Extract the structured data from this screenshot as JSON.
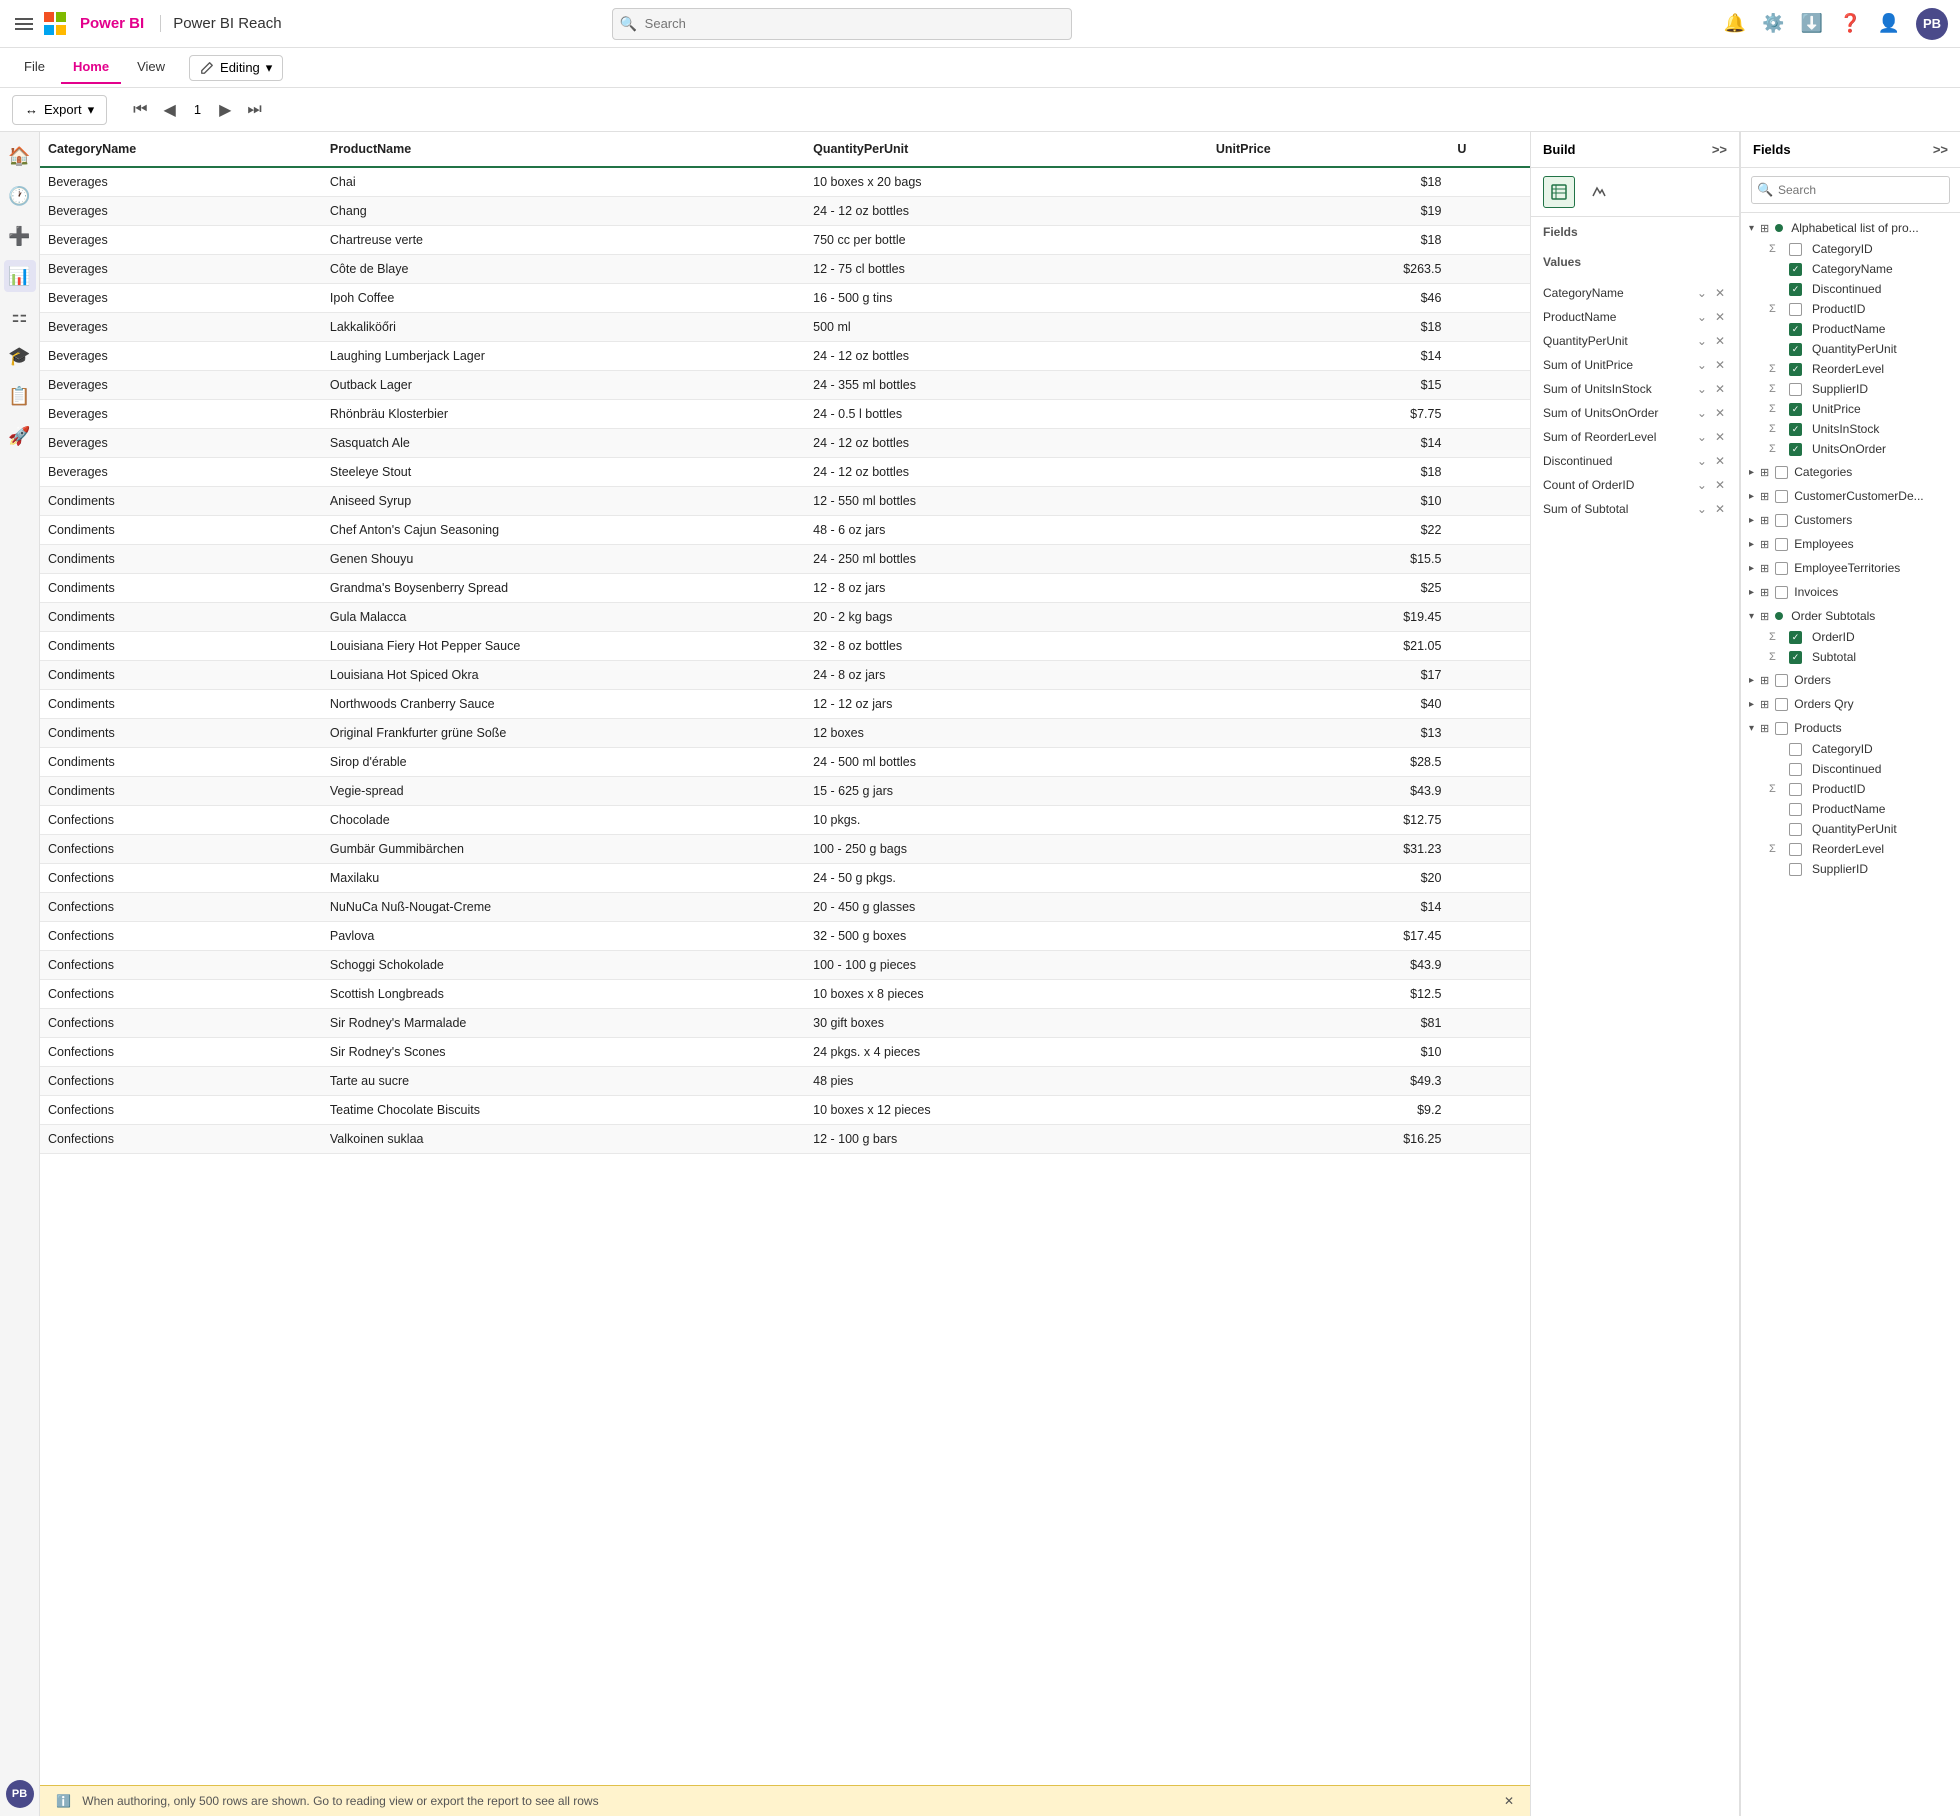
{
  "topbar": {
    "brand": "Power BI",
    "product": "Power BI Reach",
    "search_placeholder": "Search",
    "avatar_initials": "PB"
  },
  "ribbon": {
    "tabs": [
      "File",
      "Home",
      "View"
    ],
    "active_tab": "Home",
    "editing_label": "Editing"
  },
  "toolbar": {
    "export_label": "Export",
    "page_number": "1"
  },
  "table": {
    "headers": [
      "CategoryName",
      "ProductName",
      "QuantityPerUnit",
      "UnitPrice",
      "U"
    ],
    "rows": [
      [
        "Beverages",
        "Chai",
        "10 boxes x 20 bags",
        "$18",
        ""
      ],
      [
        "Beverages",
        "Chang",
        "24 - 12 oz bottles",
        "$19",
        ""
      ],
      [
        "Beverages",
        "Chartreuse verte",
        "750 cc per bottle",
        "$18",
        ""
      ],
      [
        "Beverages",
        "Côte de Blaye",
        "12 - 75 cl bottles",
        "$263.5",
        ""
      ],
      [
        "Beverages",
        "Ipoh Coffee",
        "16 - 500 g tins",
        "$46",
        ""
      ],
      [
        "Beverages",
        "Lakkaliköőri",
        "500 ml",
        "$18",
        ""
      ],
      [
        "Beverages",
        "Laughing Lumberjack Lager",
        "24 - 12 oz bottles",
        "$14",
        ""
      ],
      [
        "Beverages",
        "Outback Lager",
        "24 - 355 ml bottles",
        "$15",
        ""
      ],
      [
        "Beverages",
        "Rhönbräu Klosterbier",
        "24 - 0.5 l bottles",
        "$7.75",
        ""
      ],
      [
        "Beverages",
        "Sasquatch Ale",
        "24 - 12 oz bottles",
        "$14",
        ""
      ],
      [
        "Beverages",
        "Steeleye Stout",
        "24 - 12 oz bottles",
        "$18",
        ""
      ],
      [
        "Condiments",
        "Aniseed Syrup",
        "12 - 550 ml bottles",
        "$10",
        ""
      ],
      [
        "Condiments",
        "Chef Anton's Cajun Seasoning",
        "48 - 6 oz jars",
        "$22",
        ""
      ],
      [
        "Condiments",
        "Genen Shouyu",
        "24 - 250 ml bottles",
        "$15.5",
        ""
      ],
      [
        "Condiments",
        "Grandma's Boysenberry Spread",
        "12 - 8 oz jars",
        "$25",
        ""
      ],
      [
        "Condiments",
        "Gula Malacca",
        "20 - 2 kg bags",
        "$19.45",
        ""
      ],
      [
        "Condiments",
        "Louisiana Fiery Hot Pepper Sauce",
        "32 - 8 oz bottles",
        "$21.05",
        ""
      ],
      [
        "Condiments",
        "Louisiana Hot Spiced Okra",
        "24 - 8 oz jars",
        "$17",
        ""
      ],
      [
        "Condiments",
        "Northwoods Cranberry Sauce",
        "12 - 12 oz jars",
        "$40",
        ""
      ],
      [
        "Condiments",
        "Original Frankfurter grüne Soße",
        "12 boxes",
        "$13",
        ""
      ],
      [
        "Condiments",
        "Sirop d'érable",
        "24 - 500 ml bottles",
        "$28.5",
        ""
      ],
      [
        "Condiments",
        "Vegie-spread",
        "15 - 625 g jars",
        "$43.9",
        ""
      ],
      [
        "Confections",
        "Chocolade",
        "10 pkgs.",
        "$12.75",
        ""
      ],
      [
        "Confections",
        "Gumbär Gummibärchen",
        "100 - 250 g bags",
        "$31.23",
        ""
      ],
      [
        "Confections",
        "Maxilaku",
        "24 - 50 g pkgs.",
        "$20",
        ""
      ],
      [
        "Confections",
        "NuNuCa Nuß-Nougat-Creme",
        "20 - 450 g glasses",
        "$14",
        ""
      ],
      [
        "Confections",
        "Pavlova",
        "32 - 500 g boxes",
        "$17.45",
        ""
      ],
      [
        "Confections",
        "Schoggi Schokolade",
        "100 - 100 g pieces",
        "$43.9",
        ""
      ],
      [
        "Confections",
        "Scottish Longbreads",
        "10 boxes x 8 pieces",
        "$12.5",
        ""
      ],
      [
        "Confections",
        "Sir Rodney's Marmalade",
        "30 gift boxes",
        "$81",
        ""
      ],
      [
        "Confections",
        "Sir Rodney's Scones",
        "24 pkgs. x 4 pieces",
        "$10",
        ""
      ],
      [
        "Confections",
        "Tarte au sucre",
        "48 pies",
        "$49.3",
        ""
      ],
      [
        "Confections",
        "Teatime Chocolate Biscuits",
        "10 boxes x 12 pieces",
        "$9.2",
        ""
      ],
      [
        "Confections",
        "Valkoinen suklaa",
        "12 - 100 g bars",
        "$16.25",
        ""
      ]
    ]
  },
  "build_panel": {
    "title": "Build",
    "fields_label": "Fields",
    "values_label": "Values",
    "values": [
      "CategoryName",
      "ProductName",
      "QuantityPerUnit",
      "Sum of UnitPrice",
      "Sum of UnitsInStock",
      "Sum of UnitsOnOrder",
      "Sum of ReorderLevel",
      "Discontinued",
      "Count of OrderID",
      "Sum of Subtotal"
    ]
  },
  "fields_panel": {
    "title": "Fields",
    "search_placeholder": "Search",
    "tree": [
      {
        "id": "alphabetical",
        "label": "Alphabetical list of pro...",
        "expanded": true,
        "type": "table",
        "children": [
          {
            "label": "CategoryID",
            "checked": false,
            "sigma": true
          },
          {
            "label": "CategoryName",
            "checked": true,
            "sigma": false
          },
          {
            "label": "Discontinued",
            "checked": true,
            "sigma": false
          },
          {
            "label": "ProductID",
            "checked": false,
            "sigma": true
          },
          {
            "label": "ProductName",
            "checked": true,
            "sigma": false
          },
          {
            "label": "QuantityPerUnit",
            "checked": true,
            "sigma": false
          },
          {
            "label": "ReorderLevel",
            "checked": true,
            "sigma": true
          },
          {
            "label": "SupplierID",
            "checked": false,
            "sigma": true
          },
          {
            "label": "UnitPrice",
            "checked": true,
            "sigma": true
          },
          {
            "label": "UnitsInStock",
            "checked": true,
            "sigma": true
          },
          {
            "label": "UnitsOnOrder",
            "checked": true,
            "sigma": true
          }
        ]
      },
      {
        "id": "categories",
        "label": "Categories",
        "expanded": false,
        "type": "table",
        "children": []
      },
      {
        "id": "customer-customer-de",
        "label": "CustomerCustomerDe...",
        "expanded": false,
        "type": "table",
        "children": []
      },
      {
        "id": "customers",
        "label": "Customers",
        "expanded": false,
        "type": "table",
        "children": []
      },
      {
        "id": "employees",
        "label": "Employees",
        "expanded": false,
        "type": "table",
        "children": []
      },
      {
        "id": "employee-territories",
        "label": "EmployeeTerritories",
        "expanded": false,
        "type": "table",
        "children": []
      },
      {
        "id": "invoices",
        "label": "Invoices",
        "expanded": false,
        "type": "table",
        "children": []
      },
      {
        "id": "order-subtotals",
        "label": "Order Subtotals",
        "expanded": true,
        "type": "table",
        "children": [
          {
            "label": "OrderID",
            "checked": true,
            "sigma": true
          },
          {
            "label": "Subtotal",
            "checked": true,
            "sigma": true
          }
        ]
      },
      {
        "id": "orders",
        "label": "Orders",
        "expanded": false,
        "type": "table",
        "children": []
      },
      {
        "id": "orders-qry",
        "label": "Orders Qry",
        "expanded": false,
        "type": "table",
        "children": []
      },
      {
        "id": "products",
        "label": "Products",
        "expanded": true,
        "type": "table",
        "children": [
          {
            "label": "CategoryID",
            "checked": false,
            "sigma": false
          },
          {
            "label": "Discontinued",
            "checked": false,
            "sigma": false
          },
          {
            "label": "ProductID",
            "checked": false,
            "sigma": true
          },
          {
            "label": "ProductName",
            "checked": false,
            "sigma": false
          },
          {
            "label": "QuantityPerUnit",
            "checked": false,
            "sigma": false
          },
          {
            "label": "ReorderLevel",
            "checked": false,
            "sigma": true
          },
          {
            "label": "SupplierID",
            "checked": false,
            "sigma": false
          }
        ]
      }
    ]
  },
  "status_bar": {
    "message": "When authoring, only 500 rows are shown. Go to reading view or export the report to see all rows"
  }
}
